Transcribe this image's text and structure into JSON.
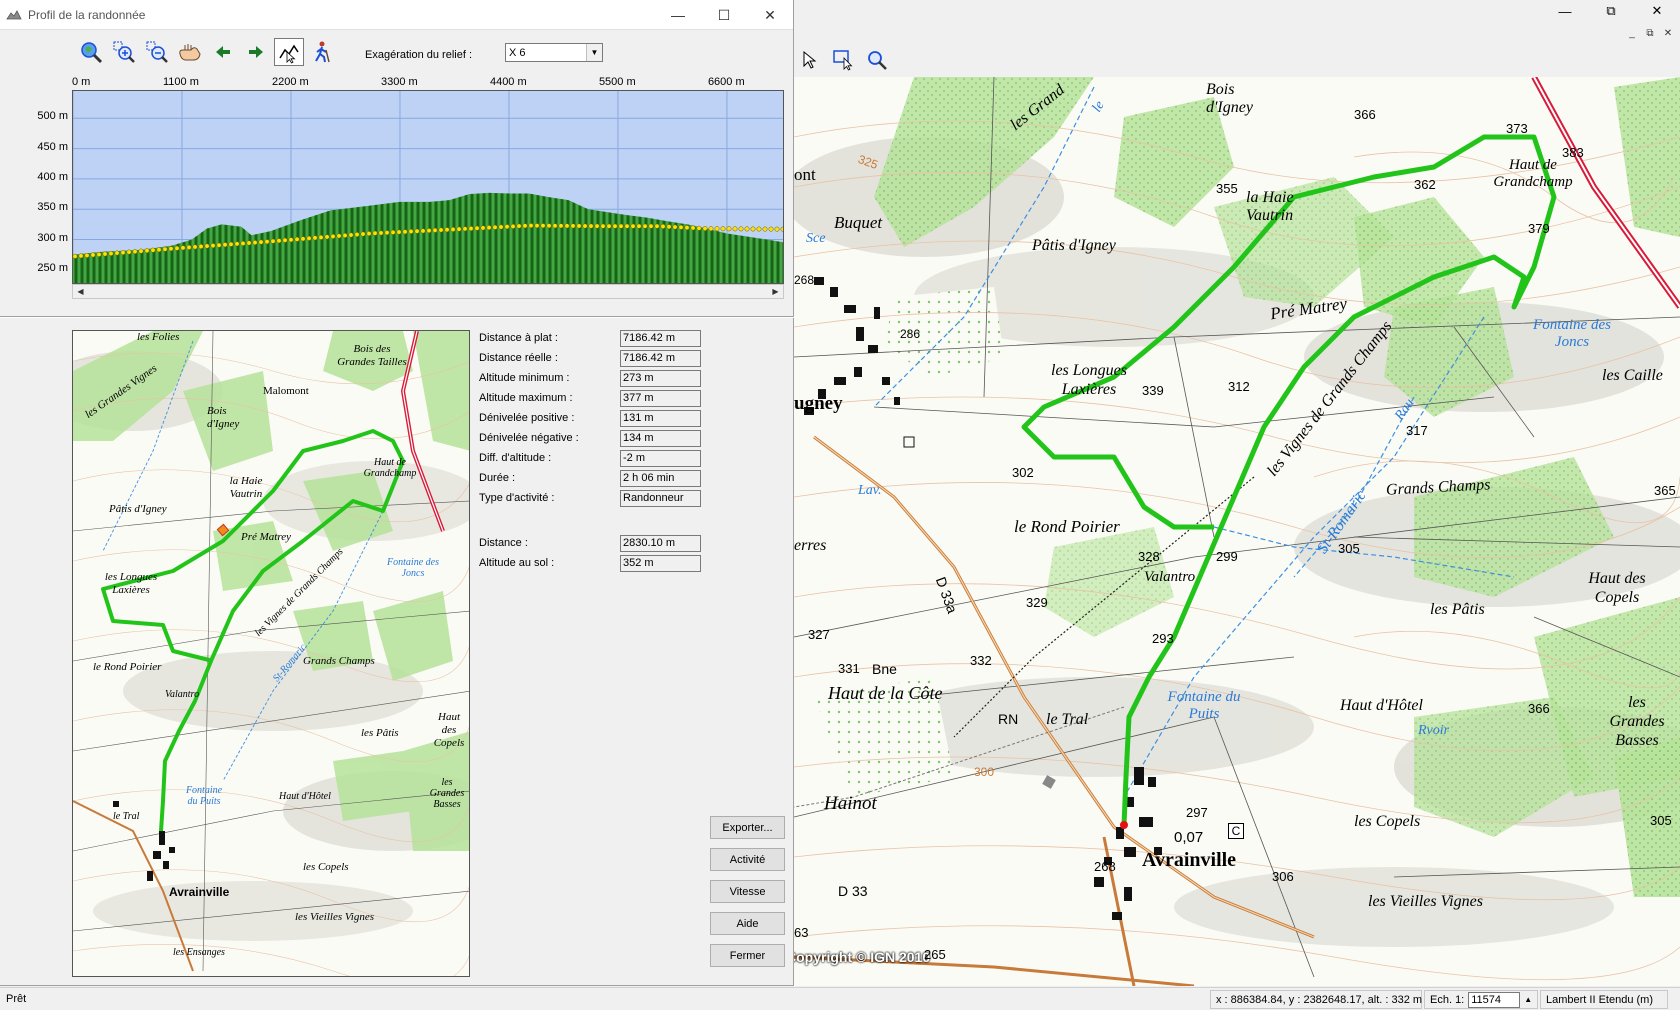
{
  "dialog": {
    "title": "Profil de la randonnée",
    "exaggeration_label": "Exagération du relief :",
    "exaggeration_value": "X 6"
  },
  "toolbar_icons": [
    "zoom-globe-icon",
    "zoom-in-icon",
    "zoom-out-icon",
    "pan-hand-icon",
    "arrow-left-icon",
    "arrow-right-icon",
    "profile-select-icon",
    "hiker-icon"
  ],
  "chart_data": {
    "type": "area",
    "x_ticks": [
      "0 m",
      "1100 m",
      "2200 m",
      "3300 m",
      "4400 m",
      "5500 m",
      "6600 m"
    ],
    "y_ticks": [
      "500 m",
      "450 m",
      "400 m",
      "350 m",
      "300 m",
      "250 m"
    ],
    "xlim": [
      0,
      7186
    ],
    "ylim": [
      225,
      545
    ],
    "terrain": {
      "x": [
        0,
        300,
        700,
        1000,
        1200,
        1350,
        1500,
        1700,
        1800,
        2000,
        2300,
        2600,
        3000,
        3300,
        3600,
        3800,
        4000,
        4200,
        4400,
        4600,
        4800,
        5000,
        5200,
        5400,
        5600,
        5800,
        6000,
        6200,
        6400,
        6600,
        6800,
        7000,
        7186
      ],
      "y": [
        275,
        280,
        283,
        290,
        300,
        318,
        325,
        321,
        307,
        314,
        332,
        348,
        356,
        362,
        362,
        365,
        375,
        377,
        376,
        376,
        370,
        365,
        350,
        345,
        340,
        336,
        330,
        325,
        318,
        310,
        305,
        300,
        295
      ]
    },
    "path_line": {
      "x": [
        0,
        1000,
        2000,
        3000,
        4000,
        4600,
        5400,
        5900,
        6400,
        7186
      ],
      "y": [
        272,
        285,
        297,
        310,
        318,
        323,
        322,
        322,
        318,
        317
      ]
    },
    "colors": {
      "sky": "#bdd2f5",
      "terrain": "#2a8a2a",
      "path": "#ffe000"
    }
  },
  "stats": [
    {
      "label": "Distance à plat :",
      "value": "7186.42 m"
    },
    {
      "label": "Distance réelle :",
      "value": "7186.42 m"
    },
    {
      "label": "Altitude minimum :",
      "value": "273 m"
    },
    {
      "label": "Altitude maximum :",
      "value": "377 m"
    },
    {
      "label": "Dénivelée positive :",
      "value": "131 m"
    },
    {
      "label": "Dénivelée négative :",
      "value": "134 m"
    },
    {
      "label": "Diff. d'altitude :",
      "value": "-2 m"
    },
    {
      "label": "Durée :",
      "value": "2 h 06 min"
    },
    {
      "label": "Type d'activité :",
      "value": "Randonneur"
    }
  ],
  "stats2": [
    {
      "label": "Distance :",
      "value": "2830.10 m"
    },
    {
      "label": "Altitude au sol :",
      "value": "352 m"
    }
  ],
  "buttons": {
    "export": "Exporter...",
    "activity": "Activité",
    "speed": "Vitesse",
    "help": "Aide",
    "close": "Fermer"
  },
  "minimap_labels": {
    "folies": "les Folies",
    "grandes_vignes": "les Grandes Vignes",
    "bois_igney": "Bois d'Igney",
    "malomont": "Malomont",
    "bois_grandes_tailles": "Bois des Grandes Tailles",
    "haie_vautrin": "la Haie Vautrin",
    "patis_igney": "Pâtis d'Igney",
    "pre_matrey": "Pré Matrey",
    "haut_grandchamp": "Haut de Grandchamp",
    "longues_laxieres": "les Longues Laxières",
    "vignes_grands_champs": "les Vignes de Grands Champs",
    "fontaine_joncs": "Fontaine des Joncs",
    "rond_poirier": "le Rond Poirier",
    "valantro": "Valantro",
    "grands_champs": "Grands Champs",
    "st_romaric": "St-Romaric",
    "les_patis": "les Pâtis",
    "haut_copels": "Haut des Copels",
    "fontaine_puits": "Fontaine du Puits",
    "haut_hotel": "Haut d'Hôtel",
    "grandes_basses": "les Grandes Basses",
    "le_tral": "le Tral",
    "les_copels": "les Copels",
    "avrainville": "Avrainville",
    "vieilles_vignes": "les Vieilles Vignes",
    "ensanges": "les Ensanges"
  },
  "map_labels": {
    "bois_igney": "Bois d'Igney",
    "les_grand": "les Grand",
    "haie_vautrin": "la Haie Vautrin",
    "haut_grandchamp": "Haut de Grandchamp",
    "buquet": "Buquet",
    "patis_igney": "Pâtis d'Igney",
    "pre_matrey": "Pré Matrey",
    "fontaine_joncs": "Fontaine des Joncs",
    "les_caille": "les Caille",
    "longues_laxieres": "les Longues Laxières",
    "vignes_grands_champs": "les Vignes de Grands Champs",
    "ugney": "ugney",
    "lav": "Lav.",
    "rond_poirier": "le Rond Poirier",
    "valantro": "Valantro",
    "st_romaric": "St-Romaric",
    "grands_champs": "Grands Champs",
    "haut_copels": "Haut des Copels",
    "les_patis": "les Pâtis",
    "erres": "erres",
    "d33a": "D 33a",
    "bne": "Bne",
    "haut_cote": "Haut de la Côte",
    "fontaine_puits": "Fontaine du Puits",
    "le_tral": "le Tral",
    "haut_hotel": "Haut d'Hôtel",
    "rvoir": "Rvoir",
    "grandes_basses": "les Grandes Basses",
    "hainot": "Hainot",
    "avrainville": "Avrainville",
    "les_copels": "les Copels",
    "vieilles_vignes": "les Vieilles Vignes",
    "d33": "D 33",
    "copyright": "Copyright © IGN 2010",
    "sce": "Sce",
    "rau": "Rau",
    "le": "le",
    "ont": "ont",
    "rn": "RN",
    "c": "C"
  },
  "map_heights": [
    "366",
    "373",
    "383",
    "325",
    "355",
    "362",
    "379",
    "268",
    "286",
    "339",
    "312",
    "317",
    "302",
    "328",
    "299",
    "305",
    "365",
    "329",
    "327",
    "331",
    "332",
    "293",
    "300",
    "297",
    "268",
    "306",
    "366",
    "305",
    "265",
    "63"
  ],
  "map_coords_vals": {
    "c007": "0,07"
  },
  "status": {
    "ready": "Prêt",
    "coords": "x : 886384.84, y : 2382648.17, alt. : 332 m",
    "scale_label": "Ech. 1:",
    "scale_value": "11574",
    "projection": "Lambert II Etendu (m)"
  }
}
